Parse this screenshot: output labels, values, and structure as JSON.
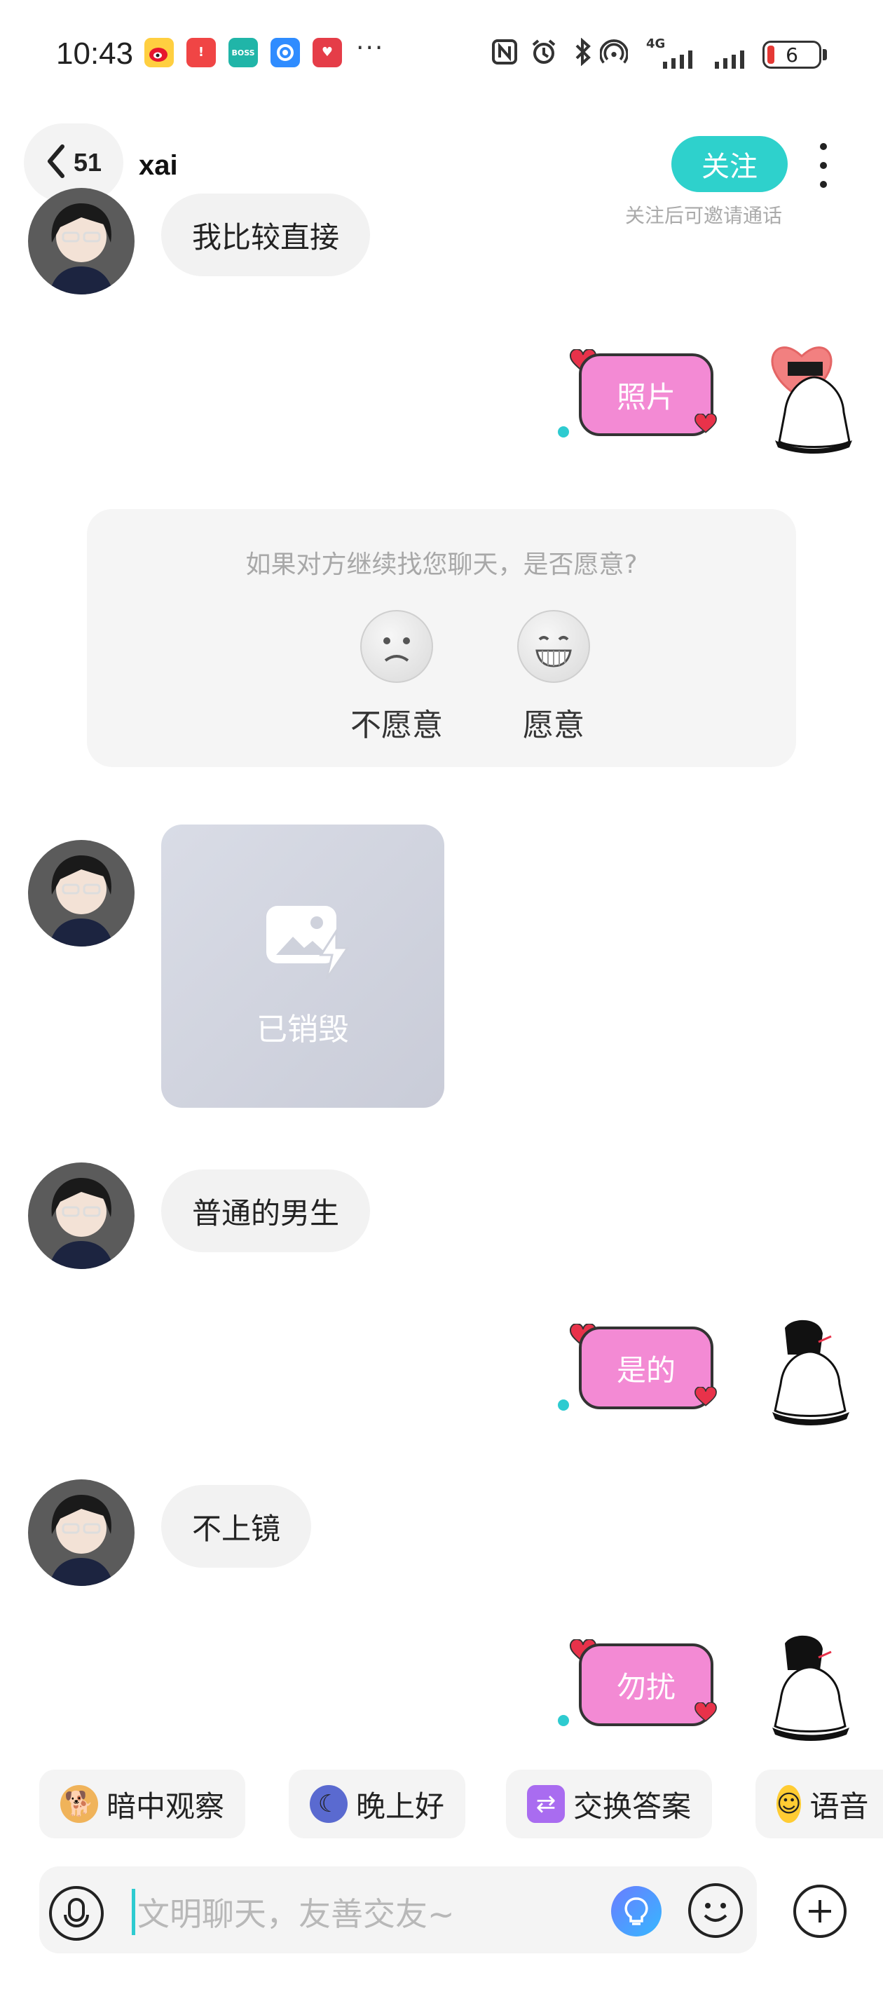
{
  "status_bar": {
    "time": "10:43",
    "apps": [
      {
        "icon": "weibo-icon",
        "color": "#ffcc33",
        "label": ""
      },
      {
        "icon": "red-alert-app-icon",
        "color": "#f04545",
        "label": ""
      },
      {
        "icon": "boss-app-icon",
        "color": "#20b5a8",
        "label": "BOSS\n直聘"
      },
      {
        "icon": "browser-app-icon",
        "color": "#2f8cff",
        "label": ""
      },
      {
        "icon": "heart-app-icon",
        "color": "#e53d48",
        "label": ""
      }
    ],
    "more_indicator": "···",
    "network_label": "4G",
    "battery_level": "6"
  },
  "header": {
    "back_count": "51",
    "title": "xai",
    "follow_label": "关注",
    "follow_hint": "关注后可邀请通话"
  },
  "messages": [
    {
      "side": "left",
      "text": "我比较直接"
    },
    {
      "side": "right",
      "text": "照片"
    },
    {
      "side": "left",
      "text": "已销毁",
      "kind": "destroyed-image"
    },
    {
      "side": "left",
      "text": "普通的男生"
    },
    {
      "side": "right",
      "text": "是的"
    },
    {
      "side": "left",
      "text": "不上镜"
    },
    {
      "side": "right",
      "text": "勿扰"
    }
  ],
  "prompt_card": {
    "question": "如果对方继续找您聊天，是否愿意?",
    "option_no": "不愿意",
    "option_yes": "愿意"
  },
  "quick_replies": [
    {
      "label": "暗中观察",
      "icon": "shiba-peek-icon"
    },
    {
      "label": "晚上好",
      "icon": "moon-face-icon"
    },
    {
      "label": "交换答案",
      "icon": "swap-icon"
    },
    {
      "label": "语音",
      "icon": "smile-face-icon"
    }
  ],
  "input": {
    "placeholder": "文明聊天，友善交友~"
  },
  "colors": {
    "accent": "#2ed1cc",
    "bubble_pink": "#f38ad4",
    "bubble_left": "#f2f2f2"
  }
}
